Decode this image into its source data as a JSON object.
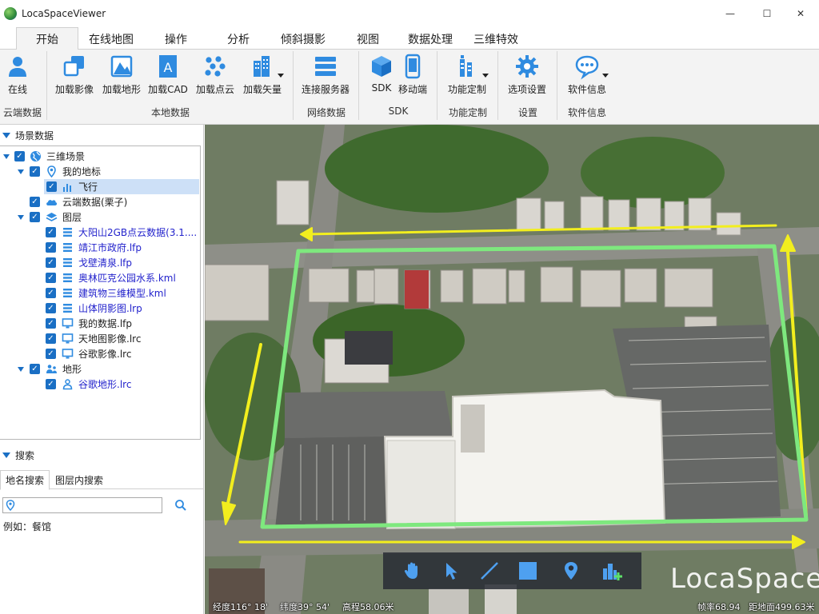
{
  "window": {
    "title": "LocaSpaceViewer",
    "minimize_glyph": "—",
    "maximize_glyph": "☐",
    "close_glyph": "✕"
  },
  "menu": {
    "tabs": [
      {
        "label": "开始",
        "active": true
      },
      {
        "label": "在线地图"
      },
      {
        "label": "操作"
      },
      {
        "label": "分析"
      },
      {
        "label": "倾斜摄影"
      },
      {
        "label": "视图"
      },
      {
        "label": "数据处理"
      },
      {
        "label": "三维特效"
      }
    ]
  },
  "ribbon": {
    "buttons": [
      {
        "label": "在线",
        "icon": "user-icon"
      },
      {
        "label": "加载影像",
        "icon": "layers-icon"
      },
      {
        "label": "加载地形",
        "icon": "terrain-icon"
      },
      {
        "label": "加载CAD",
        "icon": "cad-icon"
      },
      {
        "label": "加载点云",
        "icon": "point-cloud-icon"
      },
      {
        "label": "加载矢量",
        "icon": "vector-buildings-icon"
      },
      {
        "label": "连接服务器",
        "icon": "server-icon"
      },
      {
        "label": "SDK",
        "icon": "sdk-cube-icon"
      },
      {
        "label": "移动端",
        "icon": "mobile-icon"
      },
      {
        "label": "功能定制",
        "icon": "custom-tools-icon"
      },
      {
        "label": "选项设置",
        "icon": "gear-icon"
      },
      {
        "label": "软件信息",
        "icon": "info-bubble-icon"
      }
    ],
    "groups": [
      "云端数据",
      "本地数据",
      "网络数据",
      "SDK",
      "功能定制",
      "设置",
      "软件信息"
    ]
  },
  "scene_panel": {
    "title": "场景数据",
    "tree": [
      {
        "label": "三维场景",
        "icon": "globe-icon"
      },
      {
        "label": "我的地标",
        "icon": "placemark-icon"
      },
      {
        "label": "飞行",
        "icon": "flight-icon",
        "selected": true
      },
      {
        "label": "云端数据(栗子)",
        "icon": "cloud-icon"
      },
      {
        "label": "图层",
        "icon": "layers-icon"
      },
      {
        "label": "大阳山2GB点云数据(3.1....",
        "icon": "list-icon"
      },
      {
        "label": "靖江市政府.lfp",
        "icon": "list-icon"
      },
      {
        "label": "戈壁清泉.lfp",
        "icon": "list-icon"
      },
      {
        "label": "奥林匹克公园水系.kml",
        "icon": "list-icon"
      },
      {
        "label": "建筑物三维模型.kml",
        "icon": "list-icon"
      },
      {
        "label": "山体阴影图.lrp",
        "icon": "list-icon"
      },
      {
        "label": "我的数据.lfp",
        "icon": "monitor-icon"
      },
      {
        "label": "天地图影像.lrc",
        "icon": "monitor-icon"
      },
      {
        "label": "谷歌影像.lrc",
        "icon": "monitor-icon"
      },
      {
        "label": "地形",
        "icon": "terrain-people-icon"
      },
      {
        "label": "谷歌地形.lrc",
        "icon": "terrain-people-icon"
      }
    ]
  },
  "search_panel": {
    "title": "搜索",
    "tabs": [
      {
        "label": "地名搜索",
        "active": true
      },
      {
        "label": "图层内搜索"
      }
    ],
    "input_value": "",
    "input_placeholder": "",
    "example": "例如：餐馆"
  },
  "map": {
    "watermark": "LocaSpace",
    "toolbar": [
      "pan-hand-icon",
      "select-arrow-icon",
      "draw-line-icon",
      "draw-rectangle-icon",
      "placemark-icon",
      "add-building-icon"
    ],
    "status": {
      "longitude": "经度116° 18'",
      "latitude": "纬度39° 54'",
      "altitude": "高程58.06米",
      "frame_rate": "帧率68.94",
      "distance": "距地面499.63米"
    }
  },
  "colors": {
    "accent": "#1a6fc4",
    "ribbon_bg": "#f3f3f3",
    "route_yellow": "#f2ee1e",
    "route_green": "#7ee87e",
    "layer_text": "#2222cc"
  }
}
